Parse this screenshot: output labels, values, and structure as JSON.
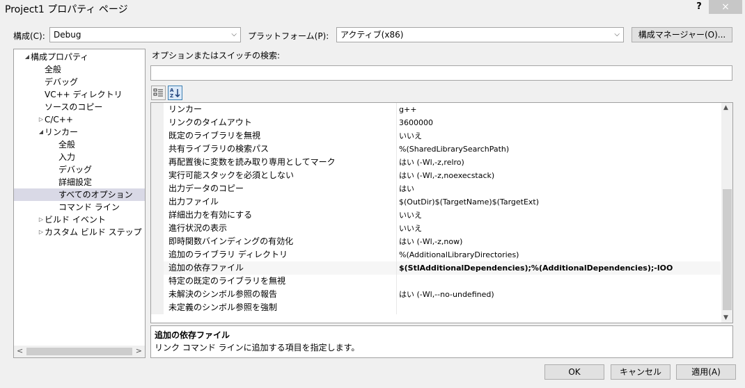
{
  "window": {
    "title": "Project1 プロパティ ページ",
    "help": "?",
    "close": "×"
  },
  "config": {
    "label": "構成(C):",
    "value": "Debug",
    "platform_label": "プラットフォーム(P):",
    "platform_value": "アクティブ(x86)",
    "manager_button": "構成マネージャー(O)..."
  },
  "tree": [
    {
      "label": "構成プロパティ",
      "indent": 0,
      "twisty": "expanded"
    },
    {
      "label": "全般",
      "indent": 1
    },
    {
      "label": "デバッグ",
      "indent": 1
    },
    {
      "label": "VC++ ディレクトリ",
      "indent": 1
    },
    {
      "label": "ソースのコピー",
      "indent": 1
    },
    {
      "label": "C/C++",
      "indent": 1,
      "twisty": "collapsed"
    },
    {
      "label": "リンカー",
      "indent": 1,
      "twisty": "expanded"
    },
    {
      "label": "全般",
      "indent": 2
    },
    {
      "label": "入力",
      "indent": 2
    },
    {
      "label": "デバッグ",
      "indent": 2
    },
    {
      "label": "詳細設定",
      "indent": 2
    },
    {
      "label": "すべてのオプション",
      "indent": 2,
      "selected": true
    },
    {
      "label": "コマンド ライン",
      "indent": 2
    },
    {
      "label": "ビルド イベント",
      "indent": 1,
      "twisty": "collapsed"
    },
    {
      "label": "カスタム ビルド ステップ",
      "indent": 1,
      "twisty": "collapsed"
    }
  ],
  "search": {
    "label": "オプションまたはスイッチの検索:",
    "value": ""
  },
  "properties": [
    {
      "name": "リンカー",
      "value": "g++"
    },
    {
      "name": "リンクのタイムアウト",
      "value": "3600000"
    },
    {
      "name": "既定のライブラリを無視",
      "value": "いいえ"
    },
    {
      "name": "共有ライブラリの検索パス",
      "value": "%(SharedLibrarySearchPath)"
    },
    {
      "name": "再配置後に変数を読み取り専用としてマーク",
      "value": "はい (-Wl,-z,relro)"
    },
    {
      "name": "実行可能スタックを必須としない",
      "value": "はい (-Wl,-z,noexecstack)"
    },
    {
      "name": "出力データのコピー",
      "value": "はい"
    },
    {
      "name": "出力ファイル",
      "value": "$(OutDir)$(TargetName)$(TargetExt)"
    },
    {
      "name": "詳細出力を有効にする",
      "value": "いいえ"
    },
    {
      "name": "進行状況の表示",
      "value": "いいえ"
    },
    {
      "name": "即時関数バインディングの有効化",
      "value": "はい (-Wl,-z,now)"
    },
    {
      "name": "追加のライブラリ ディレクトリ",
      "value": "%(AdditionalLibraryDirectories)"
    },
    {
      "name": "追加の依存ファイル",
      "value": "$(StlAdditionalDependencies);%(AdditionalDependencies);-lOO",
      "bold": true,
      "highlight": true
    },
    {
      "name": "特定の既定のライブラリを無視",
      "value": ""
    },
    {
      "name": "未解決のシンボル参照の報告",
      "value": "はい (-Wl,--no-undefined)"
    },
    {
      "name": "未定義のシンボル参照を強制",
      "value": ""
    }
  ],
  "description": {
    "title": "追加の依存ファイル",
    "text": "リンク コマンド ラインに追加する項目を指定します。"
  },
  "buttons": {
    "ok": "OK",
    "cancel": "キャンセル",
    "apply": "適用(A)"
  }
}
